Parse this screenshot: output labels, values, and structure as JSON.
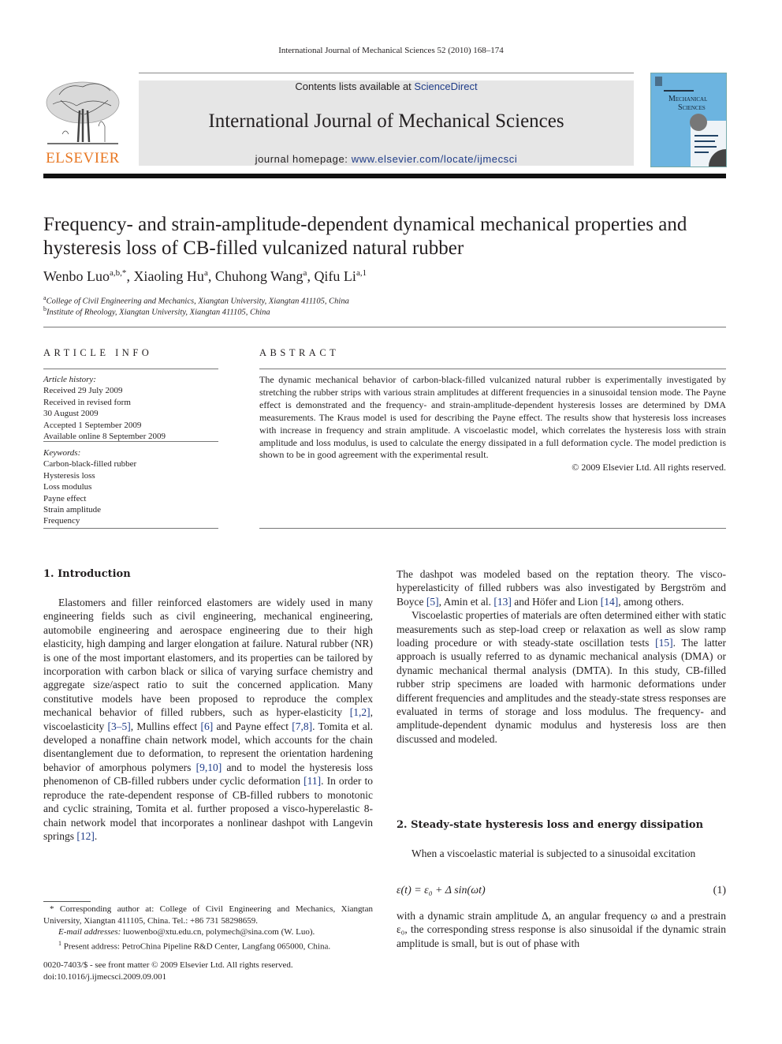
{
  "running_head": "International Journal of Mechanical Sciences 52 (2010) 168–174",
  "banner": {
    "contents_prefix": "Contents lists available at ",
    "contents_link": "ScienceDirect",
    "journal_name": "International Journal of Mechanical Sciences",
    "homepage_prefix": "journal homepage: ",
    "homepage_link": "www.elsevier.com/locate/ijmecsci",
    "publisher": "ELSEVIER",
    "cover_title_line1": "Mechanical",
    "cover_title_line2": "Sciences",
    "link_color": "#1f3c88",
    "publisher_color": "#e87722"
  },
  "article": {
    "title": "Frequency- and strain-amplitude-dependent dynamical mechanical properties and hysteresis loss of CB-filled vulcanized natural rubber",
    "authors": [
      {
        "name": "Wenbo Luo",
        "sup": "a,b,*"
      },
      {
        "name": "Xiaoling Hu",
        "sup": "a"
      },
      {
        "name": "Chuhong Wang",
        "sup": "a"
      },
      {
        "name": "Qifu Li",
        "sup": "a,1"
      }
    ],
    "affiliations": [
      {
        "sup": "a",
        "text": "College of Civil Engineering and Mechanics, Xiangtan University, Xiangtan 411105, China"
      },
      {
        "sup": "b",
        "text": "Institute of Rheology, Xiangtan University, Xiangtan 411105, China"
      }
    ]
  },
  "article_info": {
    "heading": "ARTICLE INFO",
    "history_label": "Article history:",
    "history": [
      "Received 29 July 2009",
      "Received in revised form",
      "30 August 2009",
      "Accepted 1 September 2009",
      "Available online 8 September 2009"
    ],
    "keywords_label": "Keywords:",
    "keywords": [
      "Carbon-black-filled rubber",
      "Hysteresis loss",
      "Loss modulus",
      "Payne effect",
      "Strain amplitude",
      "Frequency"
    ]
  },
  "abstract": {
    "heading": "ABSTRACT",
    "text": "The dynamic mechanical behavior of carbon-black-filled vulcanized natural rubber is experimentally investigated by stretching the rubber strips with various strain amplitudes at different frequencies in a sinusoidal tension mode. The Payne effect is demonstrated and the frequency- and strain-amplitude-dependent hysteresis losses are determined by DMA measurements. The Kraus model is used for describing the Payne effect. The results show that hysteresis loss increases with increase in frequency and strain amplitude. A viscoelastic model, which correlates the hysteresis loss with strain amplitude and loss modulus, is used to calculate the energy dissipated in a full deformation cycle. The model prediction is shown to be in good agreement with the experimental result.",
    "copyright": "© 2009 Elsevier Ltd. All rights reserved."
  },
  "body": {
    "section1_heading": "1.  Introduction",
    "s1p1_a": "Elastomers and filler reinforced elastomers are widely used in many engineering fields such as civil engineering, mechanical engineering, automobile engineering and aerospace engineering due to their high elasticity, high damping and larger elongation at failure. Natural rubber (NR) is one of the most important elastomers, and its properties can be tailored by incorporation with carbon black or silica of varying surface chemistry and aggregate size/aspect ratio to suit the concerned application. Many constitutive models have been proposed to reproduce the complex mechanical behavior of filled rubbers, such as hyper-elasticity ",
    "ref1": "[1,2]",
    "s1p1_b": ", viscoelasticity ",
    "ref2": "[3–5]",
    "s1p1_c": ", Mullins effect ",
    "ref3": "[6]",
    "s1p1_d": " and Payne effect ",
    "ref4": "[7,8]",
    "s1p1_e": ". Tomita et al. developed a nonaffine chain network model, which accounts for the chain disentanglement due to deformation, to represent the orientation hardening behavior of amorphous polymers ",
    "ref5": "[9,10]",
    "s1p1_f": " and to model the hysteresis loss phenomenon of CB-filled rubbers under cyclic deformation ",
    "ref6": "[11]",
    "s1p1_g": ". In order to reproduce the rate-dependent response of CB-filled rubbers to monotonic and cyclic straining, Tomita et al. further proposed a visco-hyperelastic 8-chain network model that incorporates a nonlinear dashpot with Langevin springs ",
    "ref7": "[12]",
    "s1p1_h": ".",
    "r1_a": "The dashpot was modeled based on the reptation theory. The visco-hyperelasticity of filled rubbers was also investigated by Bergström and Boyce ",
    "ref8": "[5]",
    "r1_b": ", Amin et al. ",
    "ref9": "[13]",
    "r1_c": " and Höfer and Lion ",
    "ref10": "[14]",
    "r1_d": ", among others.",
    "r2_a": "Viscoelastic properties of materials are often determined either with static measurements such as step-load creep or relaxation as well as slow ramp loading procedure or with steady-state oscillation tests ",
    "ref11": "[15]",
    "r2_b": ". The latter approach is usually referred to as dynamic mechanical analysis (DMA) or dynamic mechanical thermal analysis (DMTA). In this study, CB-filled rubber strip specimens are loaded with harmonic deformations under different frequencies and amplitudes and the steady-state stress responses are evaluated in terms of storage and loss modulus. The frequency- and amplitude-dependent dynamic modulus and hysteresis loss are then discussed and modeled.",
    "section2_heading": "2.  Steady-state hysteresis loss and energy dissipation",
    "s2p1": "When a viscoelastic material is subjected to a sinusoidal excitation",
    "equation": "ε(t) = ε₀ + Δ sin(ωt)",
    "equation_number": "(1)",
    "s2p2": "with a dynamic strain amplitude Δ, an angular frequency ω and a prestrain ε₀, the corresponding stress response is also sinusoidal if the dynamic strain amplitude is small, but is out of phase with"
  },
  "footnotes": {
    "corresponding": "* Corresponding author at: College of Civil Engineering and Mechanics, Xiangtan University, Xiangtan 411105, China. Tel.: +86 731 58298659.",
    "email_label": "E-mail addresses:",
    "email_1": "luowenbo@xtu.edu.cn",
    "email_2": "polymech@sina.com",
    "email_suffix": " (W. Luo).",
    "present_sup": "1",
    "present": " Present address: PetroChina Pipeline R&D Center, Langfang 065000, China."
  },
  "front_matter": {
    "issn": "0020-7403/$ - see front matter © 2009 Elsevier Ltd. All rights reserved.",
    "doi": "doi:10.1016/j.ijmecsci.2009.09.001"
  }
}
